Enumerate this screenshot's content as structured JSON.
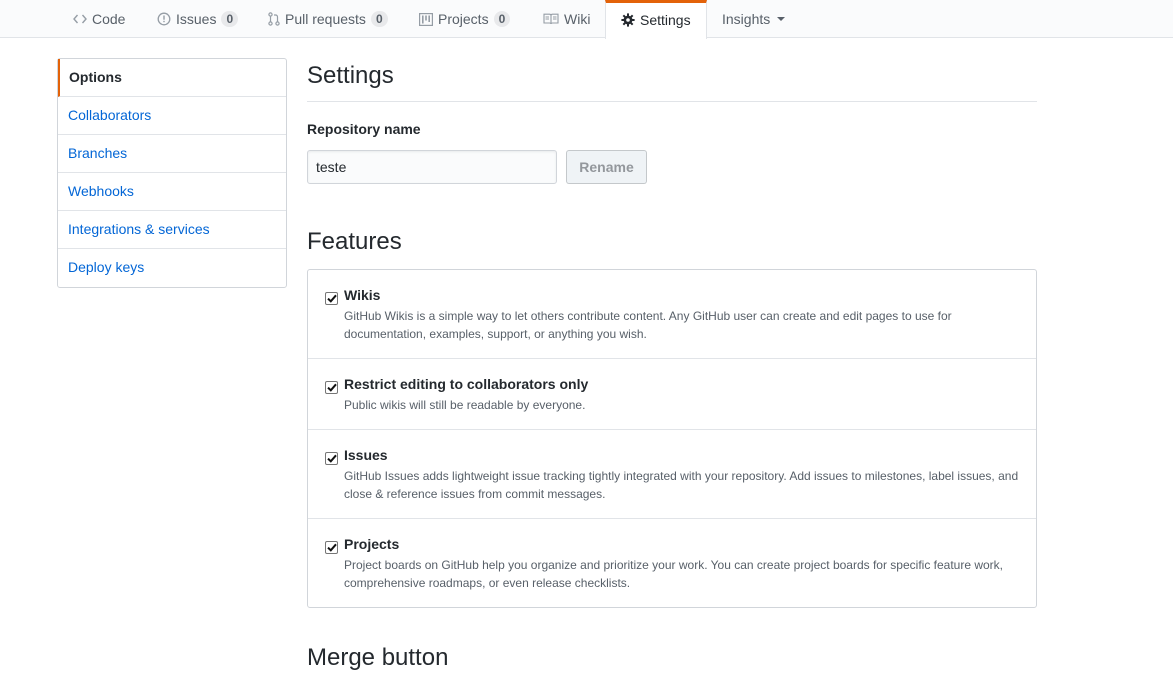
{
  "tabs": [
    {
      "label": "Code",
      "icon": "code-icon"
    },
    {
      "label": "Issues",
      "icon": "issue-opened-icon",
      "count": "0"
    },
    {
      "label": "Pull requests",
      "icon": "git-pull-request-icon",
      "count": "0"
    },
    {
      "label": "Projects",
      "icon": "project-icon",
      "count": "0"
    },
    {
      "label": "Wiki",
      "icon": "book-icon"
    },
    {
      "label": "Settings",
      "icon": "gear-icon",
      "selected": true
    },
    {
      "label": "Insights",
      "icon": "caret-down-icon"
    }
  ],
  "sidebar": {
    "items": [
      {
        "label": "Options",
        "selected": true
      },
      {
        "label": "Collaborators"
      },
      {
        "label": "Branches"
      },
      {
        "label": "Webhooks"
      },
      {
        "label": "Integrations & services"
      },
      {
        "label": "Deploy keys"
      }
    ]
  },
  "main": {
    "title": "Settings",
    "repo_name_label": "Repository name",
    "repo_name_value": "teste",
    "rename_button": "Rename",
    "features_title": "Features",
    "features": [
      {
        "name": "Wikis",
        "checked": true,
        "desc": "GitHub Wikis is a simple way to let others contribute content. Any GitHub user can create and edit pages to use for documentation, examples, support, or anything you wish."
      },
      {
        "name": "Restrict editing to collaborators only",
        "checked": true,
        "desc": "Public wikis will still be readable by everyone."
      },
      {
        "name": "Issues",
        "checked": true,
        "desc": "GitHub Issues adds lightweight issue tracking tightly integrated with your repository. Add issues to milestones, label issues, and close & reference issues from commit messages."
      },
      {
        "name": "Projects",
        "checked": true,
        "desc": "Project boards on GitHub help you organize and prioritize your work. You can create project boards for specific feature work, comprehensive roadmaps, or even release checklists."
      }
    ],
    "merge_title": "Merge button"
  },
  "colors": {
    "accent": "#e36209",
    "link": "#0366d6",
    "text": "#24292e",
    "muted": "#586069"
  }
}
